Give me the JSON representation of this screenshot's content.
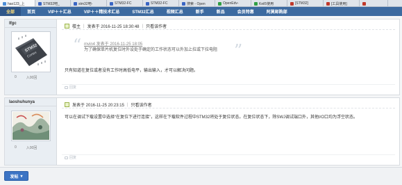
{
  "browser_tabs": [
    {
      "label": "hao123_上",
      "color": "#4c8ed9",
      "active": true
    },
    {
      "label": "STM32吧_",
      "color": "#3a66c4",
      "active": false
    },
    {
      "label": "stm32吧-",
      "color": "#3a66c4",
      "active": false
    },
    {
      "label": "STM32-FC",
      "color": "#3a66c4",
      "active": false
    },
    {
      "label": "STM32-FC",
      "color": "#3a66c4",
      "active": false
    },
    {
      "label": "搜索 - Open",
      "color": "#3a66c4",
      "active": false
    },
    {
      "label": "OpenEdv-",
      "color": "#2f9e44",
      "active": false
    },
    {
      "label": "Keil5使用",
      "color": "#2f9e44",
      "active": false
    },
    {
      "label": "[STM32]",
      "color": "#c0392b",
      "active": false
    },
    {
      "label": "[工具使用]",
      "color": "#c0392b",
      "active": false
    },
    {
      "label": "",
      "color": "#c0392b",
      "active": false
    }
  ],
  "nav": {
    "items": [
      "全部",
      "首页",
      "VIP＋＋汇总",
      "VIP＋＋精技术汇总",
      "STM32汇总",
      "视频汇总",
      "新手",
      "新品",
      "会员特惠",
      "阿莫邮购部"
    ]
  },
  "posts": [
    {
      "username": "lfgc",
      "avatar_kind": "chip",
      "chip_text_1": "STM32",
      "chip_text_2": "Cortex",
      "stat_left": "0",
      "stat_right": "入00回",
      "badge": "楼主",
      "posted": "发表于 2016-11-25 18:30:48",
      "author_only": "只看该作者",
      "quote_ref": "mvin4 发表于 2016-11-25 18:05",
      "quote_text": "为了确保单片机复位时外设处于确定的工作状态可以外加上拉或下拉电阻",
      "body": "只有知道在复位或者没有工作时高低电平，输出输入，才可以解决问题。",
      "reply_label": "回复"
    },
    {
      "username": "laoshuhunya",
      "avatar_kind": "landscape",
      "stat_left": "0",
      "stat_right": "入00回",
      "badge": "",
      "posted": "发表于 2016-11-25 20:23:15",
      "author_only": "只看该作者",
      "body": "可以在调试下载设置中选择“在复位下进行连接”，这样在下载软件过程中STM32将处于复位状态。在复位状态下，除SWJ调试端口外，其他I/O口均为浮空状态。",
      "reply_label": "回复"
    }
  ],
  "bottom": {
    "post_button": "发帖"
  }
}
